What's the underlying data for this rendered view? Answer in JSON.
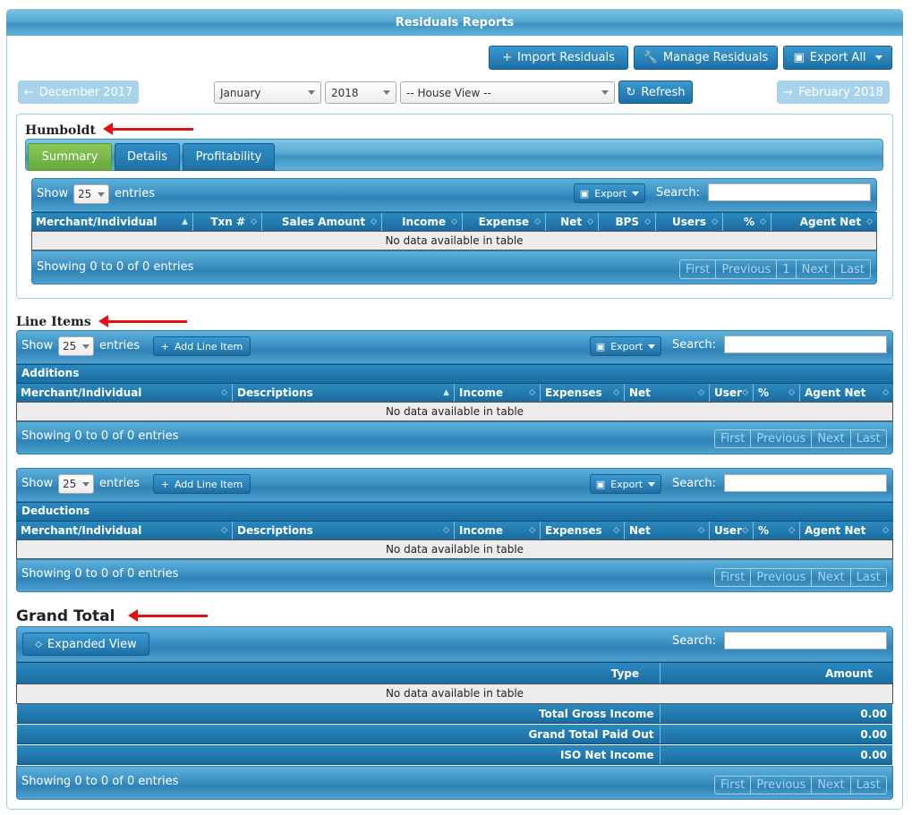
{
  "header": {
    "title": "Residuals Reports"
  },
  "toolbar": {
    "import": "Import Residuals",
    "manage": "Manage Residuals",
    "export_all": "Export All"
  },
  "nav": {
    "prev": "December 2017",
    "next": "February 2018",
    "month": "January",
    "year": "2018",
    "view": "-- House View --",
    "refresh": "Refresh"
  },
  "humboldt": {
    "title": "Humboldt",
    "tabs": [
      "Summary",
      "Details",
      "Profitability"
    ],
    "show": "Show",
    "entries_val": "25",
    "entries": "entries",
    "export": "Export",
    "search": "Search:",
    "columns": [
      "Merchant/Individual",
      "Txn #",
      "Sales Amount",
      "Income",
      "Expense",
      "Net",
      "BPS",
      "Users",
      "%",
      "Agent Net"
    ],
    "empty": "No data available in table",
    "info": "Showing 0 to 0 of 0 entries",
    "pager": [
      "First",
      "Previous",
      "1",
      "Next",
      "Last"
    ]
  },
  "line_items": {
    "title": "Line Items",
    "add": "Add Line Item",
    "show": "Show",
    "entries_val": "25",
    "entries": "entries",
    "export": "Export",
    "search": "Search:",
    "additions": {
      "group": "Additions",
      "columns": [
        "Merchant/Individual",
        "Descriptions",
        "Income",
        "Expenses",
        "Net",
        "User",
        "%",
        "Agent Net"
      ],
      "empty": "No data available in table",
      "info": "Showing 0 to 0 of 0 entries"
    },
    "deductions": {
      "group": "Deductions",
      "columns": [
        "Merchant/Individual",
        "Descriptions",
        "Income",
        "Expenses",
        "Net",
        "User",
        "%",
        "Agent Net"
      ],
      "empty": "No data available in table",
      "info": "Showing 0 to 0 of 0 entries"
    },
    "pager": [
      "First",
      "Previous",
      "Next",
      "Last"
    ]
  },
  "grand_total": {
    "title": "Grand Total",
    "expanded": "Expanded View",
    "search": "Search:",
    "col_type": "Type",
    "col_amount": "Amount",
    "empty": "No data available in table",
    "rows": [
      {
        "label": "Total Gross Income",
        "value": "0.00"
      },
      {
        "label": "Grand Total Paid Out",
        "value": "0.00"
      },
      {
        "label": "ISO Net Income",
        "value": "0.00"
      }
    ],
    "info": "Showing 0 to 0 of 0 entries",
    "pager": [
      "First",
      "Previous",
      "Next",
      "Last"
    ]
  },
  "colors": {
    "accent": "#1d6fa6",
    "active_tab": "#7dbd4a",
    "arrow": "#e51212"
  },
  "icons": {
    "plus": "plus-icon",
    "wrench": "wrench-icon",
    "save": "save-icon",
    "refresh": "refresh-icon",
    "arrow_left": "arrow-left-icon",
    "arrow_right": "arrow-right-icon",
    "sort": "sort-icon"
  }
}
